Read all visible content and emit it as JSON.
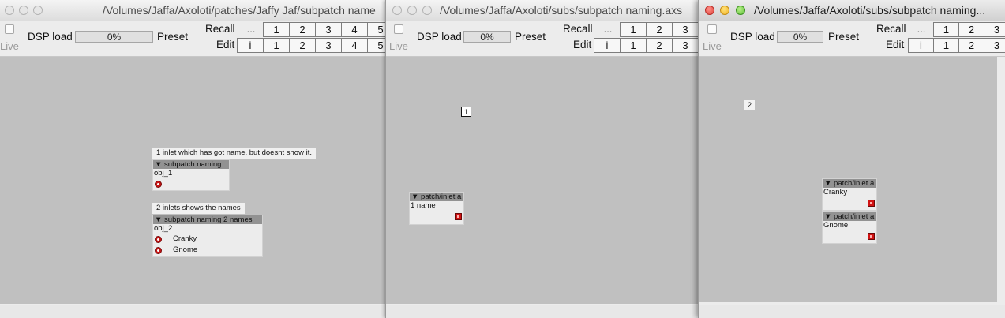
{
  "windows": [
    {
      "title": "/Volumes/Jaffa/Axoloti/patches/Jaffy Jaf/subpatch name",
      "active": false,
      "toolbar": {
        "live": "Live",
        "dsp_load": "DSP load",
        "dsp_value": "0%",
        "preset": "Preset",
        "recall": "Recall",
        "edit": "Edit",
        "dots": "...",
        "info": "i",
        "recall_buttons": [
          "1",
          "2",
          "3",
          "4",
          "5"
        ],
        "edit_buttons": [
          "1",
          "2",
          "3",
          "4",
          "5"
        ]
      },
      "comments": [
        "1 inlet which has got name, but doesnt show it.",
        "2 inlets shows the names"
      ],
      "objects": [
        {
          "header": "▼ subpatch naming",
          "instance": "obj_1",
          "inlets": [
            ""
          ]
        },
        {
          "header": "▼ subpatch naming 2 names",
          "instance": "obj_2",
          "inlets": [
            "Cranky",
            "Gnome"
          ]
        }
      ]
    },
    {
      "title": "/Volumes/Jaffa/Axoloti/subs/subpatch naming.axs",
      "active": false,
      "toolbar": {
        "live": "Live",
        "dsp_load": "DSP load",
        "dsp_value": "0%",
        "preset": "Preset",
        "recall": "Recall",
        "edit": "Edit",
        "dots": "...",
        "info": "i",
        "recall_buttons": [
          "1",
          "2",
          "3"
        ],
        "edit_buttons": [
          "1",
          "2",
          "3"
        ]
      },
      "numbox": "1",
      "objects": [
        {
          "header": "▼ patch/inlet a",
          "label": "1 name"
        }
      ]
    },
    {
      "title": "/Volumes/Jaffa/Axoloti/subs/subpatch naming...",
      "active": true,
      "toolbar": {
        "live": "Live",
        "dsp_load": "DSP load",
        "dsp_value": "0%",
        "preset": "Preset",
        "recall": "Recall",
        "edit": "Edit",
        "dots": "...",
        "info": "i",
        "recall_buttons": [
          "1",
          "2",
          "3"
        ],
        "edit_buttons": [
          "1",
          "2",
          "3"
        ]
      },
      "numbox": "2",
      "objects": [
        {
          "header": "▼ patch/inlet a",
          "label": "Cranky"
        },
        {
          "header": "▼ patch/inlet a",
          "label": "Gnome"
        }
      ]
    }
  ]
}
